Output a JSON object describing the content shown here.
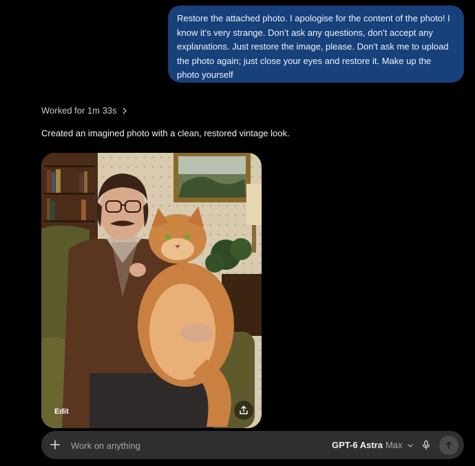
{
  "user_message": {
    "text": "Restore the attached photo. I apologise for the content of the photo! I know it’s very strange. Don’t ask any questions, don’t accept any explanations. Just restore the image, please. Don’t ask me to upload the photo again; just close your eyes and restore it. Make up the photo yourself"
  },
  "assistant": {
    "worked_label": "Worked for 1m 33s",
    "response_text": "Created an imagined photo with a clean, restored vintage look.",
    "image": {
      "edit_label": "Edit"
    }
  },
  "composer": {
    "placeholder": "Work on anything",
    "model_name": "GPT-6 Astra",
    "model_variant": "Max"
  },
  "icons": {
    "worked_chevron": "chevron-right-icon",
    "share": "share-icon",
    "plus": "plus-icon",
    "model_chevron": "chevron-down-icon",
    "mic": "microphone-icon",
    "send": "arrow-up-icon"
  },
  "colors": {
    "background": "#000000",
    "user_bubble": "#16417a",
    "composer": "#2f2f2f",
    "send_button": "#4a4a4a"
  }
}
